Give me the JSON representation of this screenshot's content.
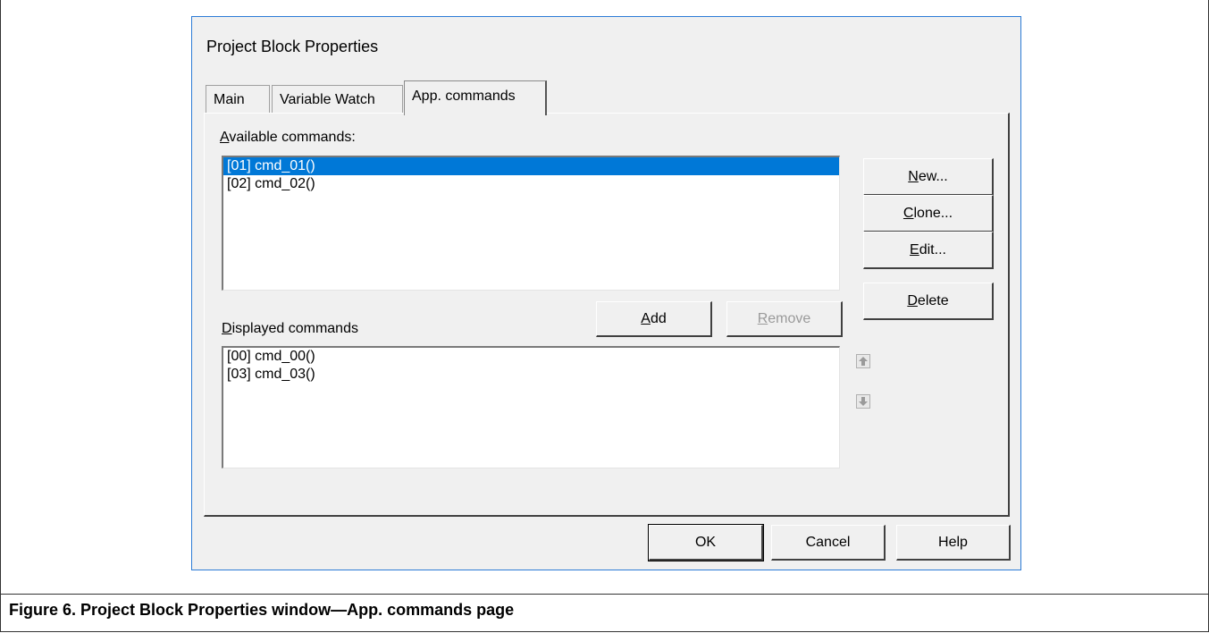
{
  "dialog": {
    "title": "Project Block Properties"
  },
  "tabs": [
    {
      "label": "Main",
      "active": false
    },
    {
      "label": "Variable Watch",
      "active": false
    },
    {
      "label": "App. commands",
      "active": true
    }
  ],
  "available": {
    "label_u": "A",
    "label_rest": "vailable commands:",
    "items": [
      "[01] cmd_01()",
      "[02] cmd_02()"
    ],
    "selected_index": 0
  },
  "displayed": {
    "label_u": "D",
    "label_rest": "isplayed commands",
    "items": [
      "[00] cmd_00()",
      "[03] cmd_03()"
    ]
  },
  "buttons": {
    "new_u": "N",
    "new_rest": "ew...",
    "clone_u": "C",
    "clone_rest": "lone...",
    "edit_u": "E",
    "edit_rest": "dit...",
    "delete_u": "D",
    "delete_rest": "elete",
    "add_u": "A",
    "add_rest": "dd",
    "remove_u": "R",
    "remove_rest": "emove",
    "ok": "OK",
    "cancel": "Cancel",
    "help": "Help"
  },
  "icons": {
    "move_up": "arrow-up-icon",
    "move_down": "arrow-down-icon"
  },
  "caption": "Figure 6. Project Block Properties window—App. commands page",
  "colors": {
    "selection": "#0078d7",
    "dialog_border": "#2c7bd6",
    "dialog_bg": "#f0f0f0"
  }
}
